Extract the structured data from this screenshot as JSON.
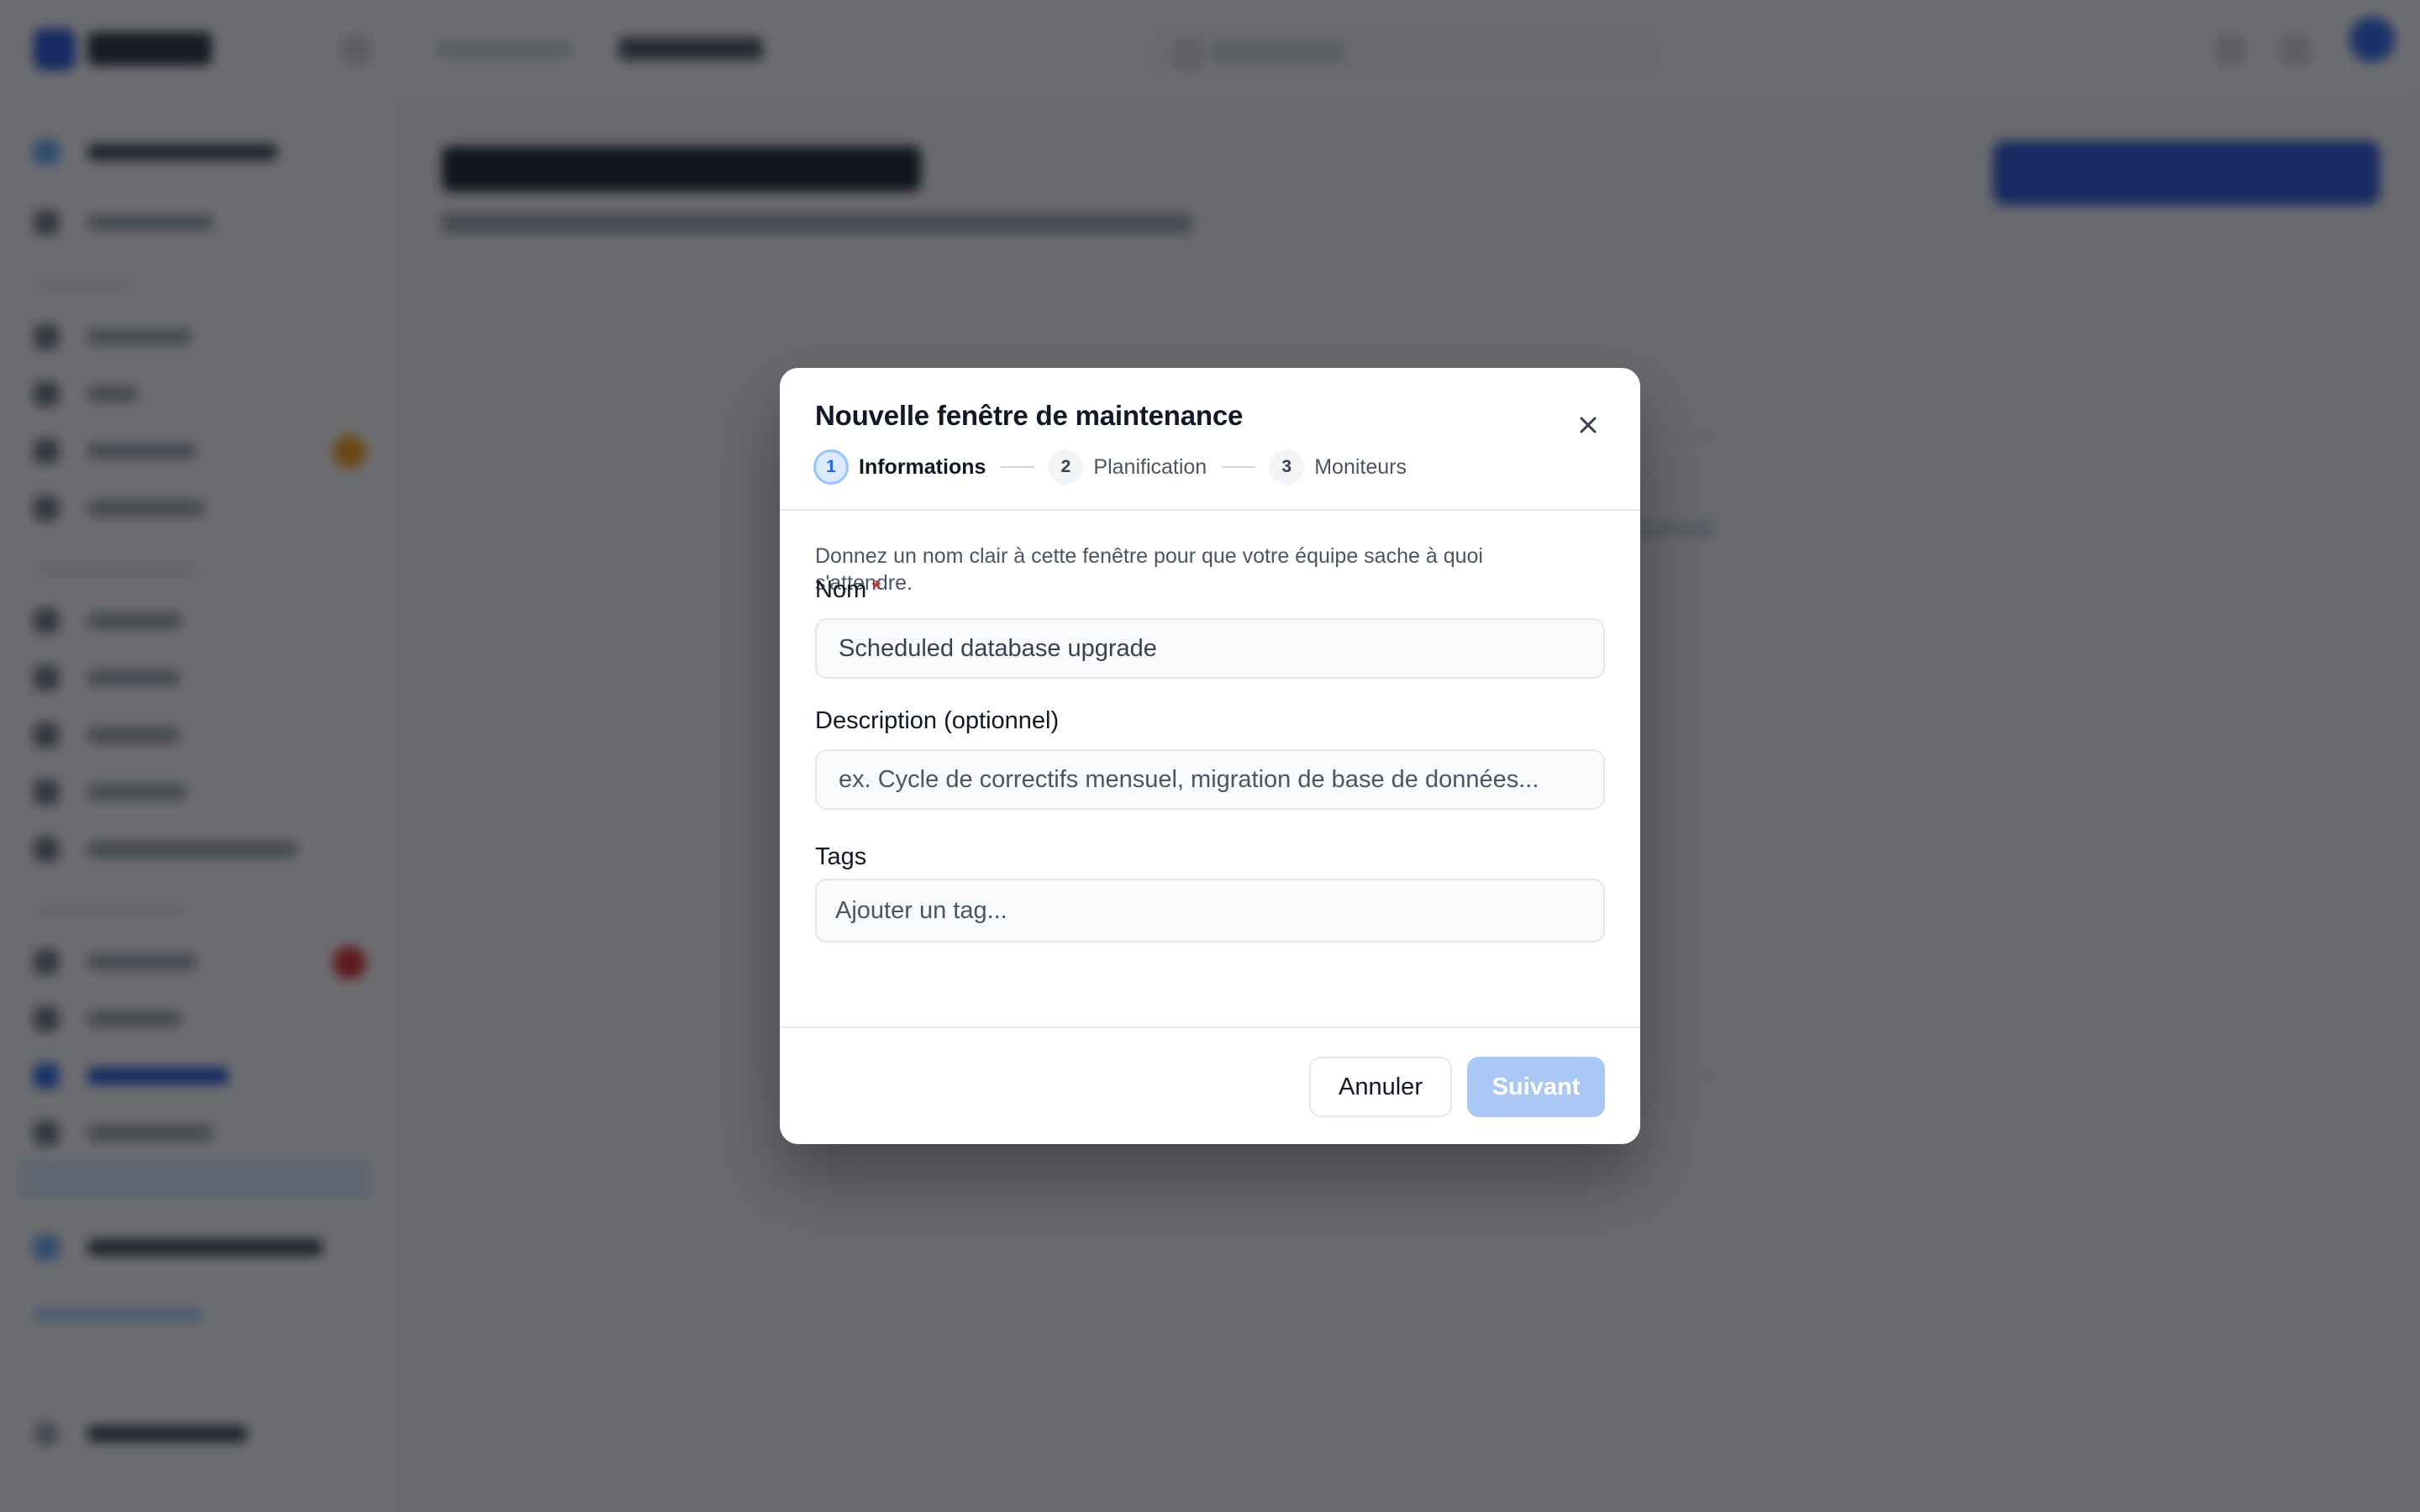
{
  "modal": {
    "title": "Nouvelle fenêtre de maintenance",
    "close_icon": "close-icon",
    "steps": [
      {
        "number": "1",
        "label": "Informations",
        "active": true
      },
      {
        "number": "2",
        "label": "Planification",
        "active": false
      },
      {
        "number": "3",
        "label": "Moniteurs",
        "active": false
      }
    ],
    "intro": "Donnez un nom clair à cette fenêtre pour que votre équipe sache à quoi s'attendre.",
    "fields": {
      "name": {
        "label": "Nom",
        "required_mark": "*",
        "value": "Scheduled database upgrade"
      },
      "description": {
        "label": "Description (optionnel)",
        "placeholder": "ex. Cycle de correctifs mensuel, migration de base de données..."
      },
      "tags": {
        "label": "Tags",
        "placeholder": "Ajouter un tag..."
      }
    },
    "buttons": {
      "cancel": "Annuler",
      "next": "Suivant"
    }
  },
  "colors": {
    "accent": "#2563eb",
    "next_disabled": "#a9c8f5",
    "required": "#dc2626",
    "overlay": "rgba(17,19,24,0.62)"
  }
}
